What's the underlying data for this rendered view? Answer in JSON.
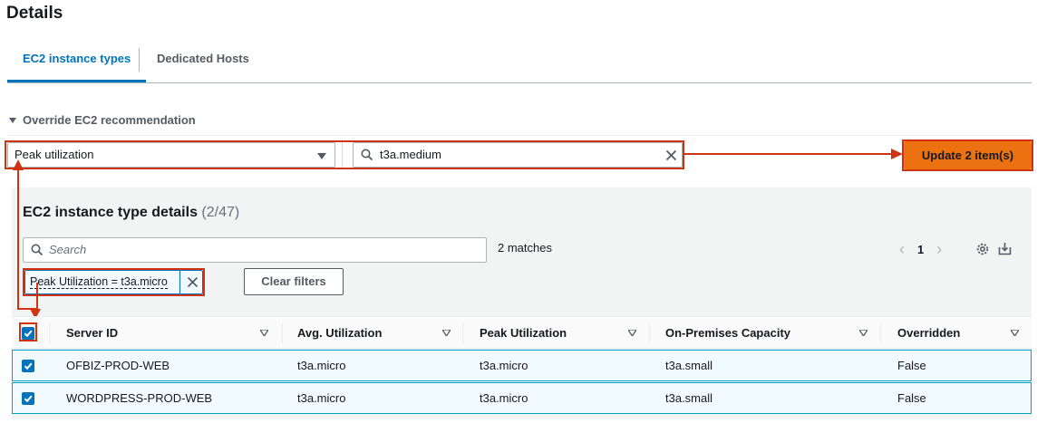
{
  "page": {
    "title": "Details"
  },
  "tabs": [
    {
      "label": "EC2 instance types",
      "active": true
    },
    {
      "label": "Dedicated Hosts",
      "active": false
    }
  ],
  "override": {
    "label": "Override EC2 recommendation"
  },
  "controls": {
    "criteria_select": "Peak utilization",
    "instance_type_value": "t3a.medium",
    "update_button": "Update 2 item(s)"
  },
  "table": {
    "title": "EC2 instance type details",
    "count": "(2/47)",
    "search_placeholder": "Search",
    "matches": "2 matches",
    "page": "1",
    "filter_token": "Peak Utilization = t3a.micro",
    "clear_filters": "Clear filters",
    "columns": [
      "Server ID",
      "Avg. Utilization",
      "Peak Utilization",
      "On-Premises Capacity",
      "Overridden"
    ],
    "rows": [
      {
        "server_id": "OFBIZ-PROD-WEB",
        "avg": "t3a.micro",
        "peak": "t3a.micro",
        "capacity": "t3a.small",
        "overridden": "False"
      },
      {
        "server_id": "WORDPRESS-PROD-WEB",
        "avg": "t3a.micro",
        "peak": "t3a.micro",
        "capacity": "t3a.small",
        "overridden": "False"
      }
    ]
  },
  "colors": {
    "accent": "#0073bb",
    "primary_button": "#ec7211",
    "annotation": "#d13212",
    "selected_row": "#f1faff"
  }
}
